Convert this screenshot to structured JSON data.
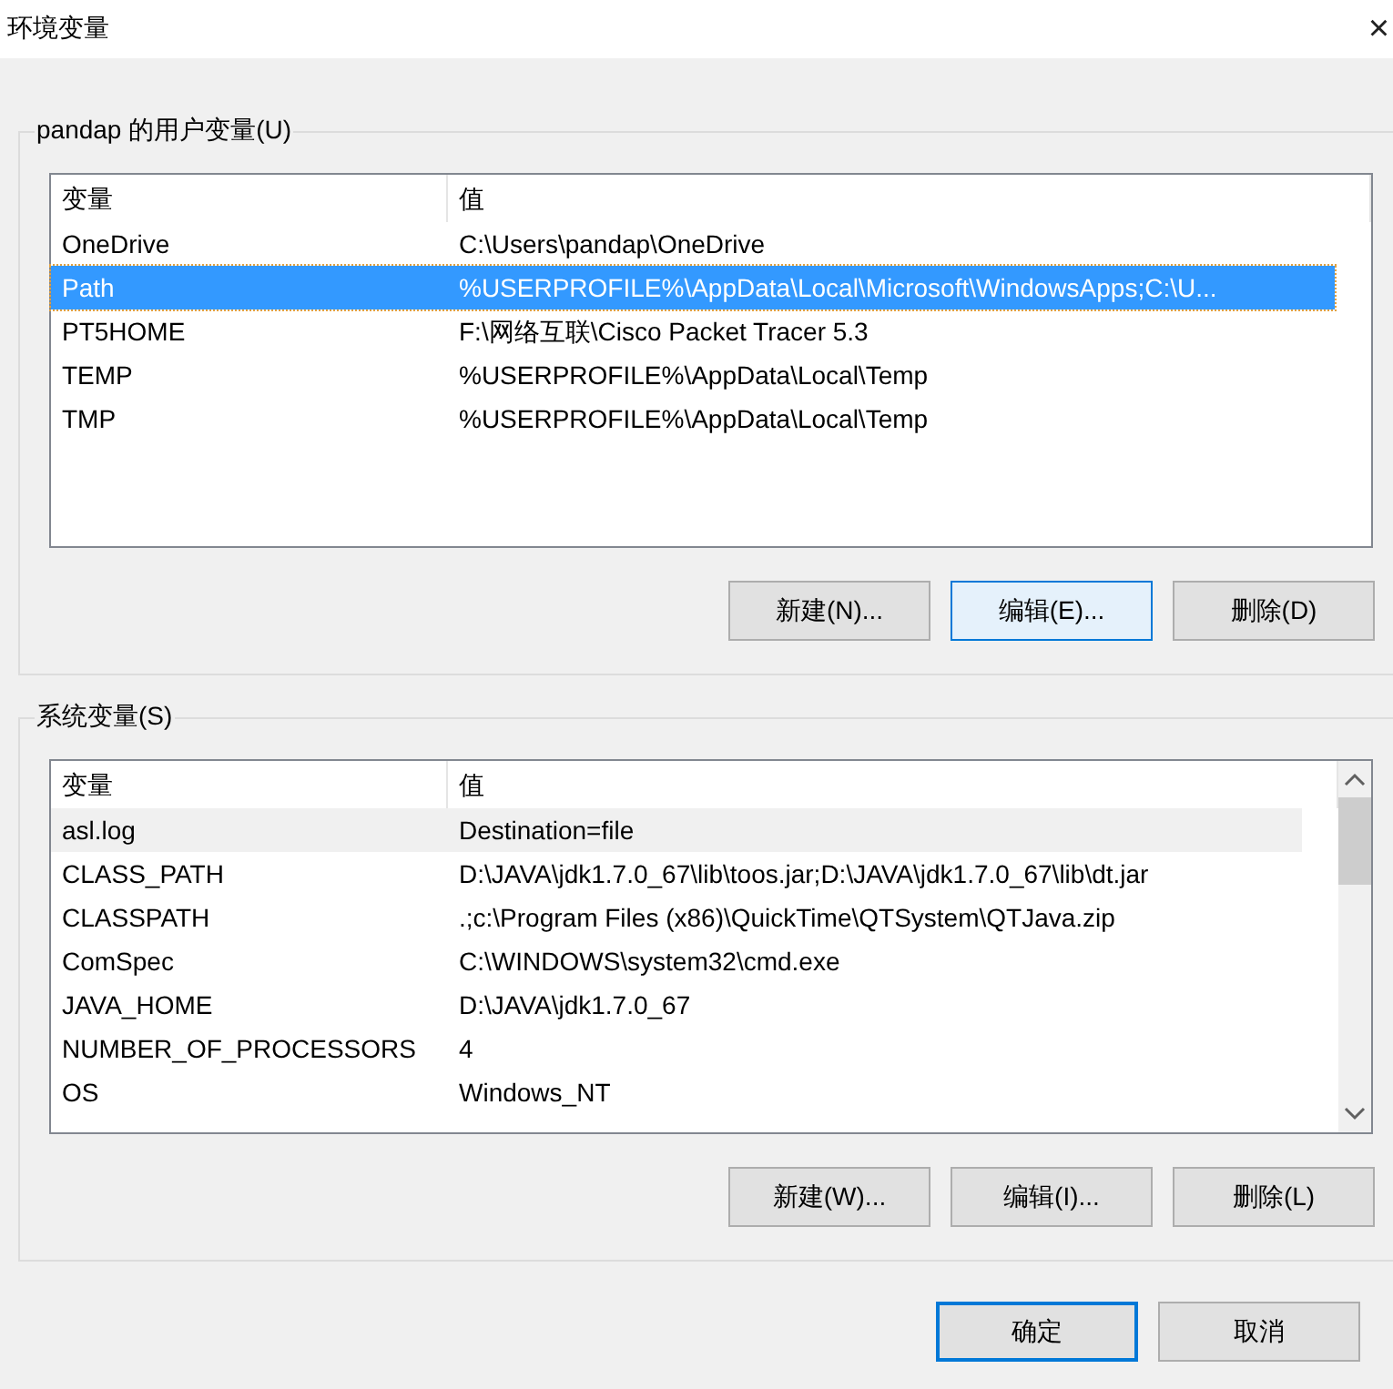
{
  "window": {
    "title": "环境变量",
    "close": "×"
  },
  "groups": [
    {
      "title": "pandap 的用户变量(U)",
      "focused": true,
      "columns": [
        "变量",
        "值"
      ],
      "rows": [
        {
          "name": "OneDrive",
          "value": "C:\\Users\\pandap\\OneDrive",
          "selected": false
        },
        {
          "name": "Path",
          "value": "%USERPROFILE%\\AppData\\Local\\Microsoft\\WindowsApps;C:\\U...",
          "selected": true
        },
        {
          "name": "PT5HOME",
          "value": "F:\\网络互联\\Cisco Packet Tracer 5.3",
          "selected": false
        },
        {
          "name": "TEMP",
          "value": "%USERPROFILE%\\AppData\\Local\\Temp",
          "selected": false
        },
        {
          "name": "TMP",
          "value": "%USERPROFILE%\\AppData\\Local\\Temp",
          "selected": false
        }
      ],
      "buttons": [
        {
          "label": "新建(N)...",
          "focused": false
        },
        {
          "label": "编辑(E)...",
          "focused": true
        },
        {
          "label": "删除(D)",
          "focused": false
        }
      ]
    },
    {
      "title": "系统变量(S)",
      "scrollbar": true,
      "focused": false,
      "columns": [
        "变量",
        "值"
      ],
      "rows": [
        {
          "name": "asl.log",
          "value": "Destination=file",
          "selected": true
        },
        {
          "name": "CLASS_PATH",
          "value": "D:\\JAVA\\jdk1.7.0_67\\lib\\toos.jar;D:\\JAVA\\jdk1.7.0_67\\lib\\dt.jar",
          "selected": false
        },
        {
          "name": "CLASSPATH",
          "value": ".;c:\\Program Files (x86)\\QuickTime\\QTSystem\\QTJava.zip",
          "selected": false
        },
        {
          "name": "ComSpec",
          "value": "C:\\WINDOWS\\system32\\cmd.exe",
          "selected": false
        },
        {
          "name": "JAVA_HOME",
          "value": "D:\\JAVA\\jdk1.7.0_67",
          "selected": false
        },
        {
          "name": "NUMBER_OF_PROCESSORS",
          "value": "4",
          "selected": false
        },
        {
          "name": "OS",
          "value": "Windows_NT",
          "selected": false
        }
      ],
      "buttons": [
        {
          "label": "新建(W)...",
          "focused": false
        },
        {
          "label": "编辑(I)...",
          "focused": false
        },
        {
          "label": "删除(L)",
          "focused": false
        }
      ]
    }
  ],
  "footer_buttons": [
    {
      "label": "确定",
      "focused": true
    },
    {
      "label": "取消",
      "focused": false
    }
  ]
}
